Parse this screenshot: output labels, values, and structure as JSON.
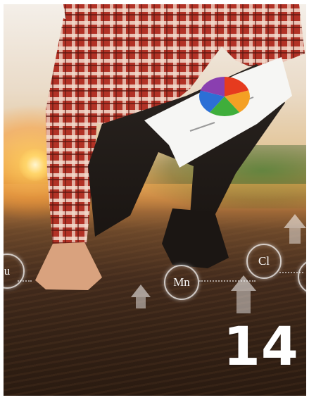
{
  "elements": [
    {
      "symbol": "u"
    },
    {
      "symbol": "Mn"
    },
    {
      "symbol": "Cl"
    }
  ],
  "page_number": "14",
  "pie_chart": {
    "colors": [
      "#e63b1e",
      "#f4a024",
      "#3fae3b",
      "#2c6fd6",
      "#8a3fb0"
    ]
  }
}
